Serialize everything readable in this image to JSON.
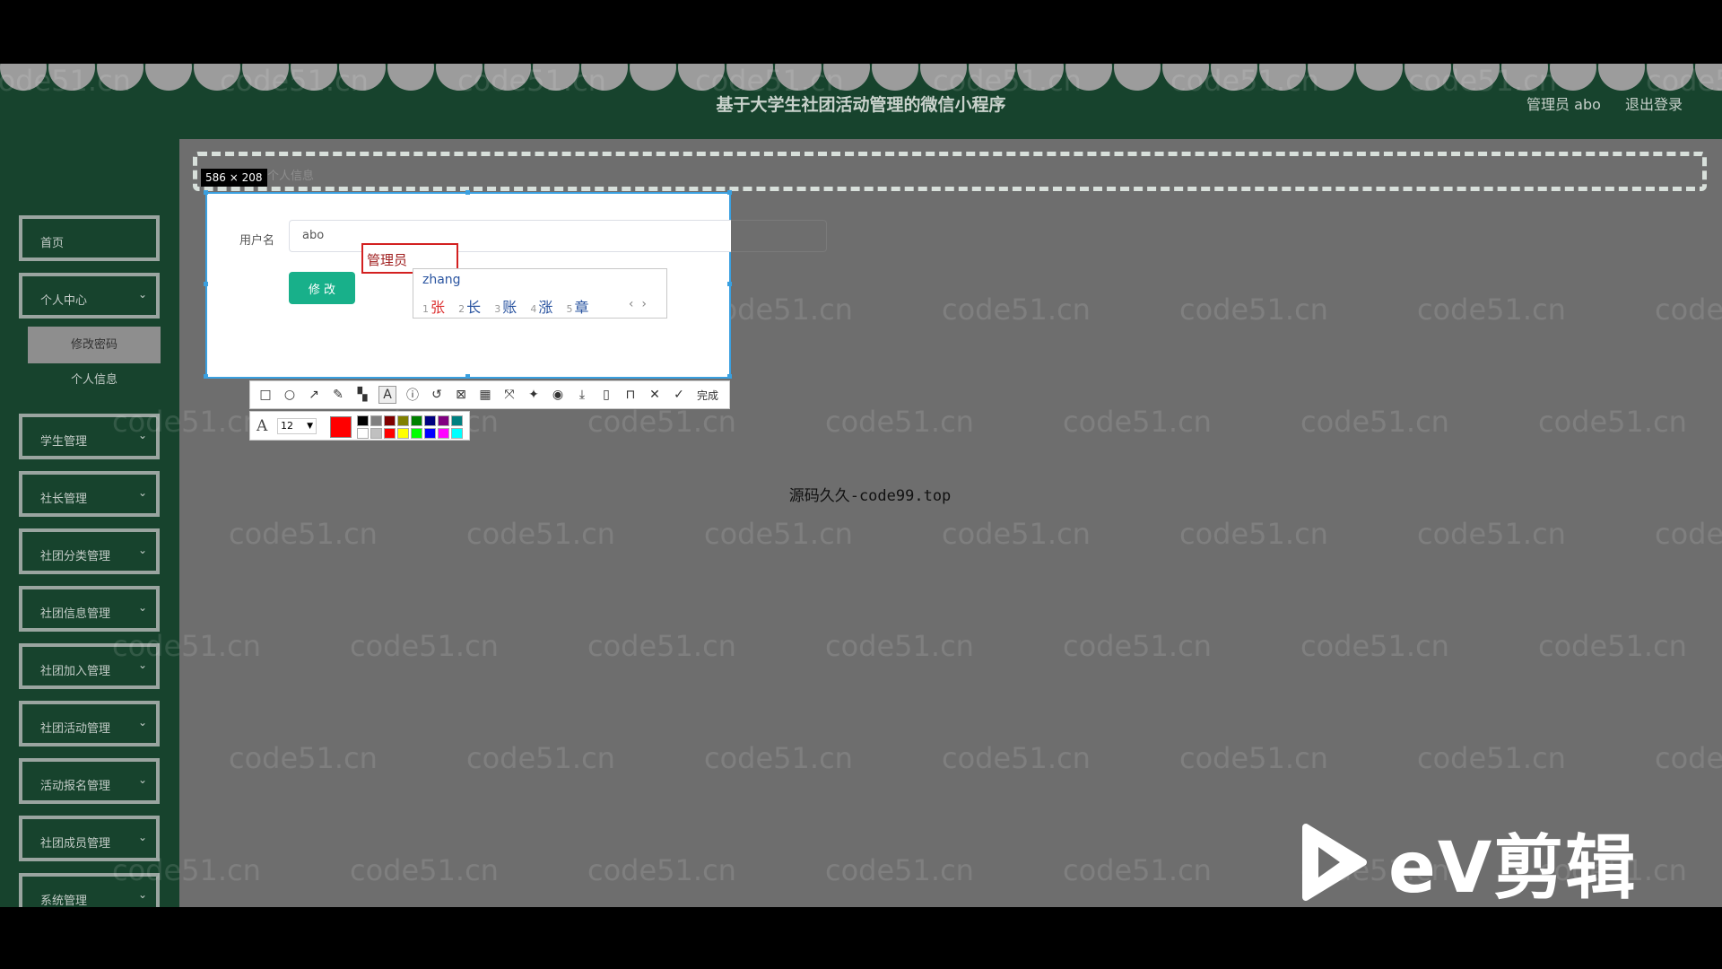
{
  "site_title": "基于大学生社团活动管理的微信小程序",
  "header": {
    "user": "管理员 abo",
    "logout": "退出登录"
  },
  "sidebar": {
    "home": "首页",
    "personal_center": "个人中心",
    "sub_change_password": "修改密码",
    "sub_profile": "个人信息",
    "items": [
      "学生管理",
      "社长管理",
      "社团分类管理",
      "社团信息管理",
      "社团加入管理",
      "社团活动管理",
      "活动报名管理",
      "社团成员管理",
      "系统管理"
    ]
  },
  "breadcrumb": "个人信息",
  "capture": {
    "size_label": "586 × 208",
    "username_label": "用户名",
    "username_value": "abo",
    "modify_button": "修 改",
    "typed_text": "管理员",
    "ime": {
      "pinyin": "zhang",
      "candidates": [
        {
          "num": "1",
          "char": "张"
        },
        {
          "num": "2",
          "char": "长"
        },
        {
          "num": "3",
          "char": "账"
        },
        {
          "num": "4",
          "char": "涨"
        },
        {
          "num": "5",
          "char": "章"
        }
      ],
      "prev": "‹",
      "next": "›"
    },
    "toolbar": {
      "icons": [
        "rectangle-icon",
        "ellipse-icon",
        "arrow-icon",
        "pencil-icon",
        "mosaic-icon",
        "text-icon",
        "number-icon",
        "undo-icon",
        "pin-icon",
        "ocr-icon",
        "expand-icon",
        "pushpin-icon",
        "record-icon",
        "download-icon",
        "save-icon",
        "bookmark-icon",
        "close-icon",
        "check-icon"
      ],
      "done_label": "完成",
      "font_size": "12",
      "current_color": "#ff0000",
      "palette": [
        "#000000",
        "#808080",
        "#800000",
        "#808000",
        "#008000",
        "#000080",
        "#800080",
        "#008080",
        "#ffffff",
        "#c0c0c0",
        "#ff0000",
        "#ffff00",
        "#00ff00",
        "#0000ff",
        "#ff00ff",
        "#00ffff"
      ]
    }
  },
  "center_text": "源码久久-code99.top",
  "watermark": "code51.cn",
  "ev_logo": "eV剪辑",
  "colors": {
    "header_bg": "#17432d",
    "button_green": "#18b08a",
    "content_bg": "#6e6e6e"
  }
}
